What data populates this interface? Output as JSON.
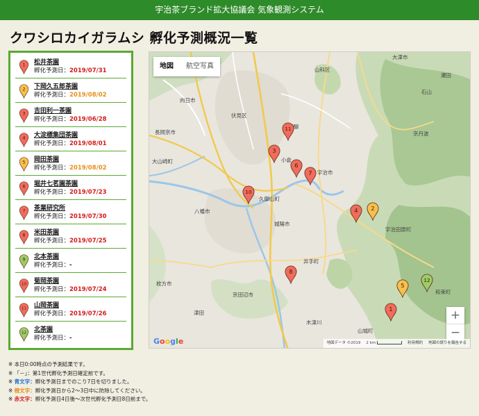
{
  "header": {
    "system_title": "宇治茶ブランド拡大協議会 気象観測システム"
  },
  "page": {
    "title": "クワシロカイガラムシ 孵化予測概況一覧"
  },
  "colors": {
    "red": "#f26b5b",
    "orange": "#f7c04a",
    "green": "#9ccc65",
    "brand_green": "#2e8b2a"
  },
  "list": {
    "pred_label": "孵化予測日：",
    "items": [
      {
        "num": "1",
        "name": "松井茶園",
        "date": "2019/07/31",
        "color": "red"
      },
      {
        "num": "2",
        "name": "下岡久五郎茶園",
        "date": "2019/08/02",
        "color": "orange"
      },
      {
        "num": "3",
        "name": "吉田利一茶園",
        "date": "2019/06/28",
        "color": "red"
      },
      {
        "num": "4",
        "name": "大淀標集団茶園",
        "date": "2019/08/01",
        "color": "red"
      },
      {
        "num": "5",
        "name": "岡田茶園",
        "date": "2019/08/02",
        "color": "orange"
      },
      {
        "num": "6",
        "name": "堀井七茗園茶園",
        "date": "2019/07/23",
        "color": "red"
      },
      {
        "num": "7",
        "name": "茶業研究所",
        "date": "2019/07/30",
        "color": "red"
      },
      {
        "num": "8",
        "name": "米田茶園",
        "date": "2019/07/25",
        "color": "red"
      },
      {
        "num": "9",
        "name": "北本茶園",
        "date": "-",
        "color": "green"
      },
      {
        "num": "10",
        "name": "菊岡茶園",
        "date": "2019/07/24",
        "color": "red"
      },
      {
        "num": "11",
        "name": "山岡茶園",
        "date": "2019/07/26",
        "color": "red"
      },
      {
        "num": "12",
        "name": "北茶園",
        "date": "-",
        "color": "green"
      }
    ]
  },
  "map": {
    "tab_map": "地図",
    "tab_satellite": "航空写真",
    "zoom_in": "+",
    "zoom_out": "−",
    "google": "Google",
    "attribution": "地図データ ©2019",
    "scale": "2 km",
    "terms": "利用規約",
    "report": "地図の誤りを報告する",
    "places": {
      "uji": "宇治市",
      "yawata": "八幡市",
      "hirakata": "枚方市",
      "kyotanabe": "京田辺市",
      "joyo": "城陽市",
      "kumiyama": "久御山町",
      "ujitawara": "宇治田原町",
      "wazuka": "和束町",
      "yamashina": "山科区",
      "fushimi": "伏見区",
      "muko": "向日市",
      "nagaokakyo": "長岡京市",
      "oyamazaki": "大山崎町",
      "ide": "井手町",
      "yamashiro": "山城町",
      "otsu": "大津市",
      "seta": "瀬田",
      "daigo": "醍醐",
      "ishiyama": "石山",
      "ogura": "小倉",
      "tsuda": "津田",
      "kizu": "木津川",
      "kyotamba": "京丹波"
    },
    "markers": [
      {
        "num": "1",
        "color": "red"
      },
      {
        "num": "2",
        "color": "orange"
      },
      {
        "num": "3",
        "color": "red"
      },
      {
        "num": "4",
        "color": "red"
      },
      {
        "num": "5",
        "color": "orange"
      },
      {
        "num": "6",
        "color": "red"
      },
      {
        "num": "7",
        "color": "red"
      },
      {
        "num": "8",
        "color": "red"
      },
      {
        "num": "10",
        "color": "red"
      },
      {
        "num": "11",
        "color": "red"
      },
      {
        "num": "12",
        "color": "green"
      }
    ]
  },
  "notes": {
    "n1": "※ 本日0:00時点の予測結果です。",
    "n2": "※ 「－」：第1世代孵化予測日確定前です。",
    "n3_key": "青文字：",
    "n3_text": "孵化予測日までのこり7日を切りました。",
    "n4_key": "橙文字：",
    "n4_text": "孵化予測日から2～3日中に防除してください。",
    "n5_key": "赤文字：",
    "n5_text": "孵化予測日4日後～次世代孵化予測日8日前まで。",
    "prefix": "※ "
  }
}
